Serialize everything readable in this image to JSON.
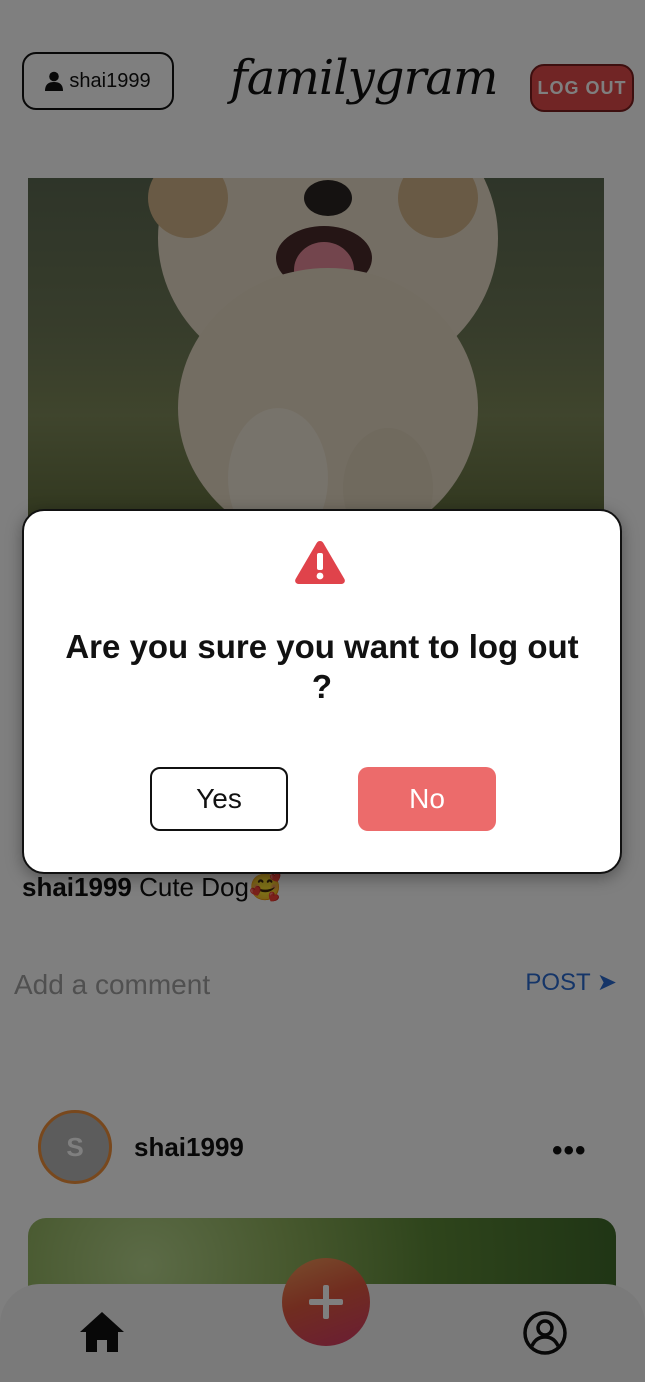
{
  "header": {
    "username": "shai1999",
    "logo": "familygram",
    "logout_label": "LOG OUT"
  },
  "post": {
    "caption_user": "shai1999",
    "caption_text": " Cute Dog🥰",
    "comment_placeholder": "Add a comment",
    "post_button": "POST ➤"
  },
  "post2": {
    "avatar_letter": "S",
    "username": "shai1999",
    "more_label": "•••"
  },
  "dialog": {
    "title": "Are you sure you want to log out ?",
    "yes_label": "Yes",
    "no_label": "No"
  },
  "colors": {
    "accent_red": "#e24b4b",
    "no_button": "#ec6b6b",
    "link_blue": "#2a6bd1",
    "avatar_ring": "#f0903b"
  },
  "icons": [
    "user-icon",
    "home-icon",
    "add-icon",
    "profile-icon",
    "warning-icon"
  ]
}
